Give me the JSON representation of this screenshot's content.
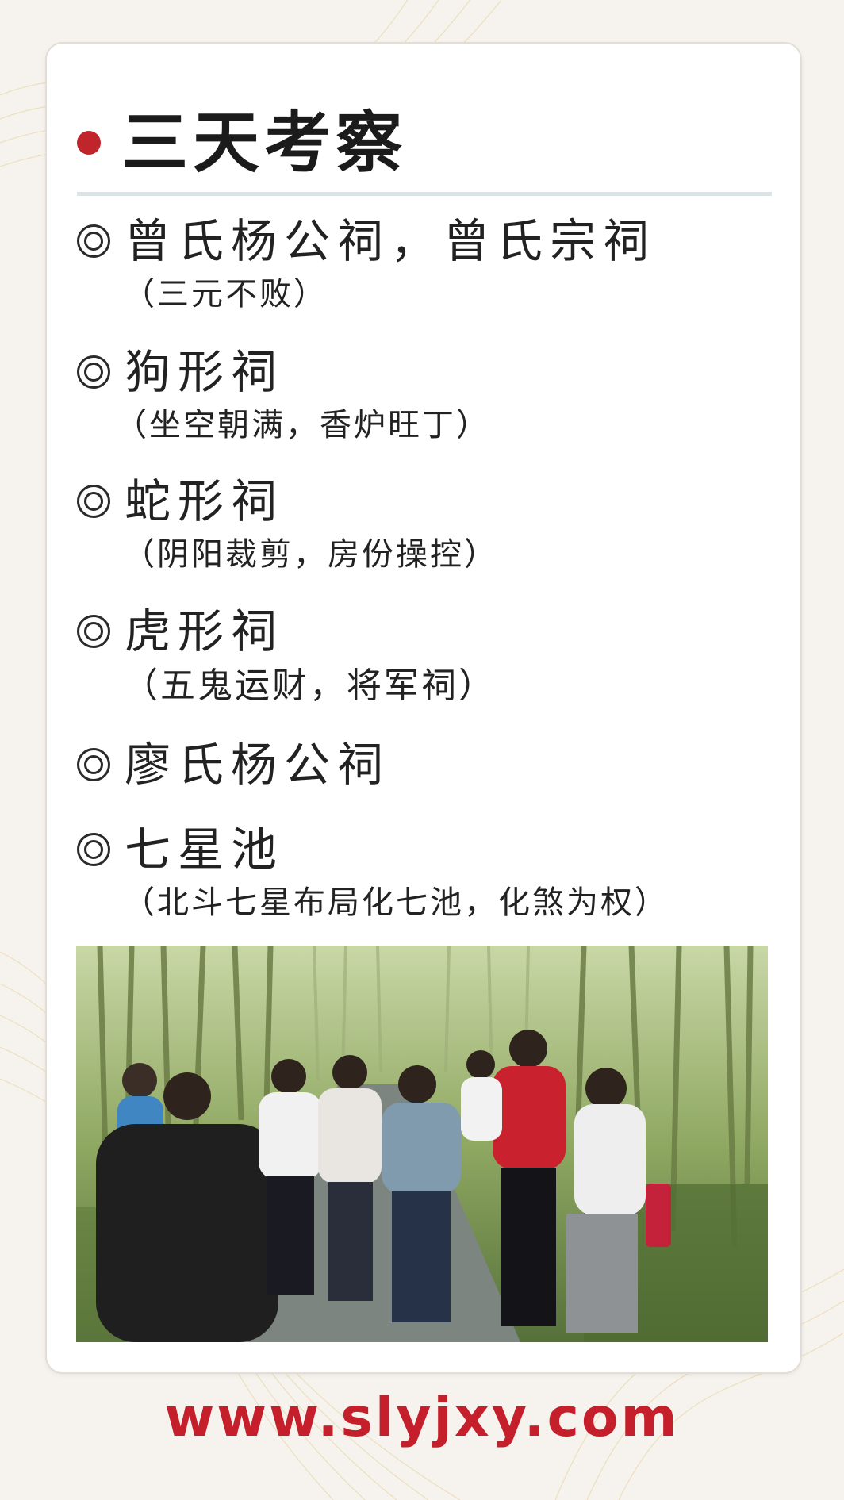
{
  "title": "三天考察",
  "items": [
    {
      "name": "曾氏杨公祠，曾氏宗祠",
      "note": "（三元不败）"
    },
    {
      "name": "狗形祠",
      "note": "（坐空朝满，香炉旺丁）"
    },
    {
      "name": "蛇形祠",
      "note": "（阴阳裁剪，房份操控）"
    },
    {
      "name": "虎形祠",
      "note": "（五鬼运财，将军祠）"
    },
    {
      "name": "廖氏杨公祠"
    },
    {
      "name": "七星池",
      "note": "（北斗七星布局化七池，化煞为权）"
    }
  ],
  "website": "www.slyjxy.com",
  "colors": {
    "accent": "#c0252b",
    "url": "#c41f2a"
  }
}
